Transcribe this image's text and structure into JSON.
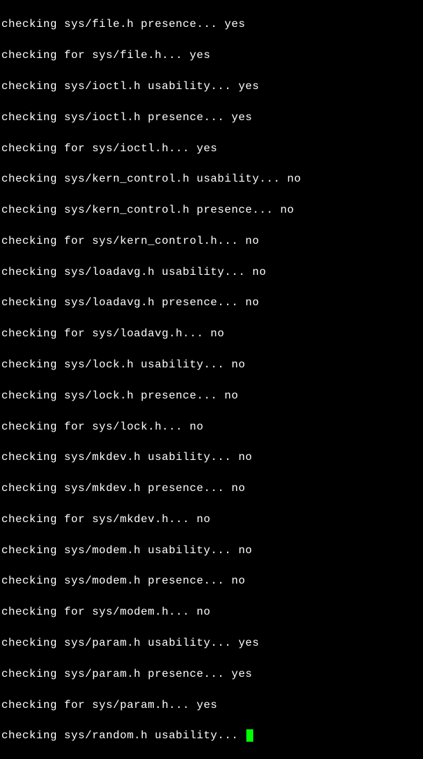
{
  "terminal": {
    "lines": [
      "checking sys/file.h presence... yes",
      "checking for sys/file.h... yes",
      "checking sys/ioctl.h usability... yes",
      "checking sys/ioctl.h presence... yes",
      "checking for sys/ioctl.h... yes",
      "checking sys/kern_control.h usability... no",
      "checking sys/kern_control.h presence... no",
      "checking for sys/kern_control.h... no",
      "checking sys/loadavg.h usability... no",
      "checking sys/loadavg.h presence... no",
      "checking for sys/loadavg.h... no",
      "checking sys/lock.h usability... no",
      "checking sys/lock.h presence... no",
      "checking for sys/lock.h... no",
      "checking sys/mkdev.h usability... no",
      "checking sys/mkdev.h presence... no",
      "checking for sys/mkdev.h... no",
      "checking sys/modem.h usability... no",
      "checking sys/modem.h presence... no",
      "checking for sys/modem.h... no",
      "checking sys/param.h usability... yes",
      "checking sys/param.h presence... yes",
      "checking for sys/param.h... yes",
      "checking sys/random.h usability... "
    ]
  }
}
